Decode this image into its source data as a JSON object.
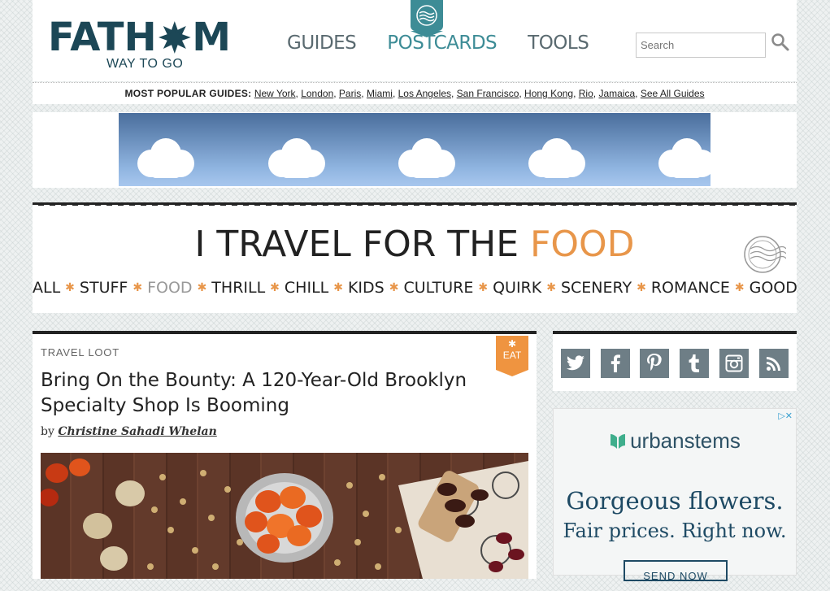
{
  "brand": {
    "logo_left": "FATH",
    "logo_right": "M",
    "tagline": "WAY TO GO"
  },
  "nav": {
    "guides": "GUIDES",
    "postcards": "POSTCARDS",
    "tools": "TOOLS"
  },
  "search": {
    "placeholder": "Search"
  },
  "popular": {
    "label": "MOST POPULAR GUIDES:",
    "links": [
      "New York",
      "London",
      "Paris",
      "Miami",
      "Los Angeles",
      "San Francisco",
      "Hong Kong",
      "Rio",
      "Jamaica",
      "See All Guides"
    ]
  },
  "section": {
    "title_prefix": "I TRAVEL FOR THE",
    "title_accent": "FOOD",
    "categories": [
      "ALL",
      "STUFF",
      "FOOD",
      "THRILL",
      "CHILL",
      "KIDS",
      "CULTURE",
      "QUIRK",
      "SCENERY",
      "ROMANCE",
      "GOOD"
    ],
    "separator": "✱"
  },
  "article": {
    "kicker": "TRAVEL LOOT",
    "badge_icon": "✱",
    "badge": "EAT",
    "headline": "Bring On the Bounty: A 120-Year-Old Brooklyn Specialty Shop Is Booming",
    "by": "by",
    "author": "Christine Sahadi Whelan"
  },
  "ad": {
    "brand": "urbanstems",
    "headline": "Gorgeous flowers.",
    "subline": "Fair prices. Right now.",
    "cta": "SEND NOW",
    "choices": "▷✕"
  },
  "colors": {
    "brand": "#1c4756",
    "accent": "#e8964a",
    "teal": "#3d8c96",
    "social": "#6e7e86"
  }
}
